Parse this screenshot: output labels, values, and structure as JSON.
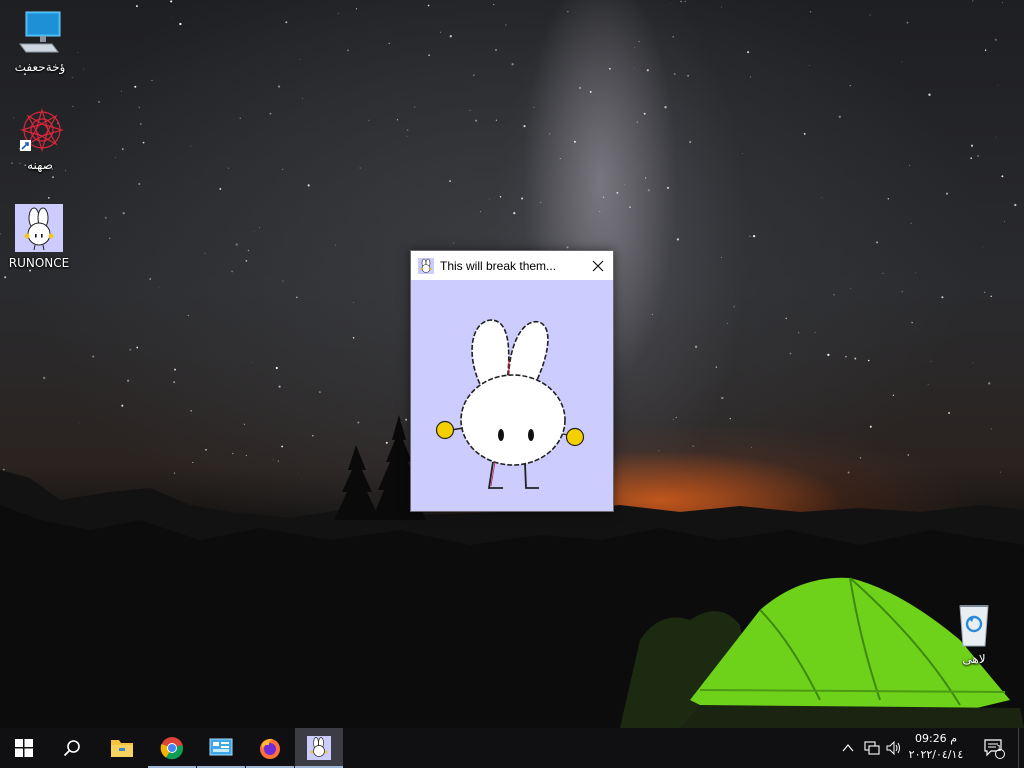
{
  "desktop": {
    "icons": [
      {
        "label": "ؤخةحعفث",
        "icon": "computer-icon"
      },
      {
        "label": "صهنه",
        "icon": "red-mandala-shortcut-icon"
      },
      {
        "label": "RUNONCE",
        "icon": "bunny-app-icon"
      },
      {
        "label": "لاهى",
        "icon": "recycle-bin-icon"
      }
    ]
  },
  "window": {
    "title": "This will break them...",
    "icon": "bunny-app-icon",
    "background": "#ccccff"
  },
  "taskbar": {
    "apps": [
      {
        "name": "start",
        "icon": "windows-logo-icon"
      },
      {
        "name": "search",
        "icon": "search-icon"
      },
      {
        "name": "file-explorer",
        "icon": "folder-icon"
      },
      {
        "name": "chrome",
        "icon": "chrome-icon"
      },
      {
        "name": "control-panel",
        "icon": "control-panel-icon"
      },
      {
        "name": "firefox",
        "icon": "firefox-icon"
      },
      {
        "name": "bunny",
        "icon": "bunny-app-icon"
      }
    ],
    "tray": {
      "time": "09:26 م",
      "date": "٢٠٢٢/٠٤/١٤",
      "notifications_count": "1"
    }
  },
  "colors": {
    "taskbar": "#101012",
    "window_client": "#ccccff",
    "tent": "#7ed321",
    "sunset": "#ff6e1e"
  }
}
